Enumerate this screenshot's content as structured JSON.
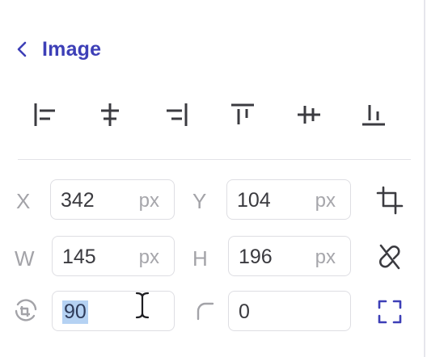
{
  "header": {
    "back_label": "Image",
    "back_icon": "chevron-left-icon",
    "accent_color": "#3d3fb7"
  },
  "alignment": [
    {
      "name": "align-left",
      "icon": "align-left-icon"
    },
    {
      "name": "align-horizontal-center",
      "icon": "align-horizontal-center-icon"
    },
    {
      "name": "align-right",
      "icon": "align-right-icon"
    },
    {
      "name": "align-top",
      "icon": "align-top-icon"
    },
    {
      "name": "align-vertical-center",
      "icon": "align-vertical-center-icon"
    },
    {
      "name": "align-bottom",
      "icon": "align-bottom-icon"
    }
  ],
  "position": {
    "x_label": "X",
    "x_value": "342",
    "x_unit": "px",
    "y_label": "Y",
    "y_value": "104",
    "y_unit": "px",
    "crop_icon": "crop-icon"
  },
  "size": {
    "w_label": "W",
    "w_value": "145",
    "w_unit": "px",
    "h_label": "H",
    "h_value": "196",
    "h_unit": "px",
    "lock_icon": "unlinked-aspect-ratio-icon"
  },
  "transform": {
    "rotation_icon": "rotate-icon",
    "rotation_value": "90",
    "radius_icon": "corner-radius-icon",
    "radius_value": "0",
    "fullscreen_icon": "fit-frame-icon"
  },
  "colors": {
    "selection": "#b5d2f3",
    "muted_text": "#a3a3a8",
    "field_border": "#dedee3",
    "icon": "#3b3b40"
  }
}
